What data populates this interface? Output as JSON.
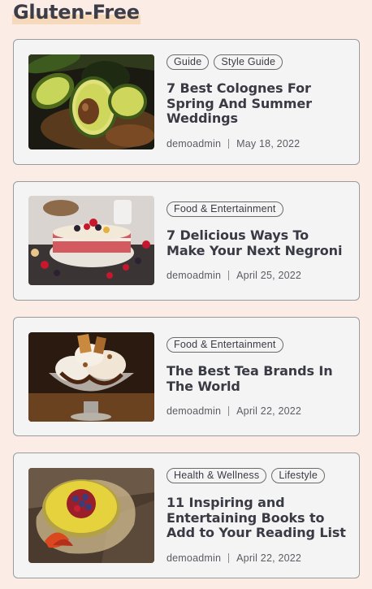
{
  "section": {
    "title": "Gluten-Free"
  },
  "posts": [
    {
      "tags": [
        "Guide",
        "Style Guide"
      ],
      "title": "7 Best Colognes For Spring And Summer Weddings",
      "author": "demoadmin",
      "date": "May 18, 2022",
      "image": "avocado-photo"
    },
    {
      "tags": [
        "Food & Entertainment"
      ],
      "title": "7 Delicious Ways To Make Your Next Negroni",
      "author": "demoadmin",
      "date": "April 25, 2022",
      "image": "berry-cake-photo"
    },
    {
      "tags": [
        "Food & Entertainment"
      ],
      "title": "The Best Tea Brands In The World",
      "author": "demoadmin",
      "date": "April 22, 2022",
      "image": "ice-cream-sundae-photo"
    },
    {
      "tags": [
        "Health & Wellness",
        "Lifestyle"
      ],
      "title": "11 Inspiring and Entertaining Books to Add to Your Reading List",
      "author": "demoadmin",
      "date": "April 22, 2022",
      "image": "fruit-tart-photo"
    }
  ]
}
